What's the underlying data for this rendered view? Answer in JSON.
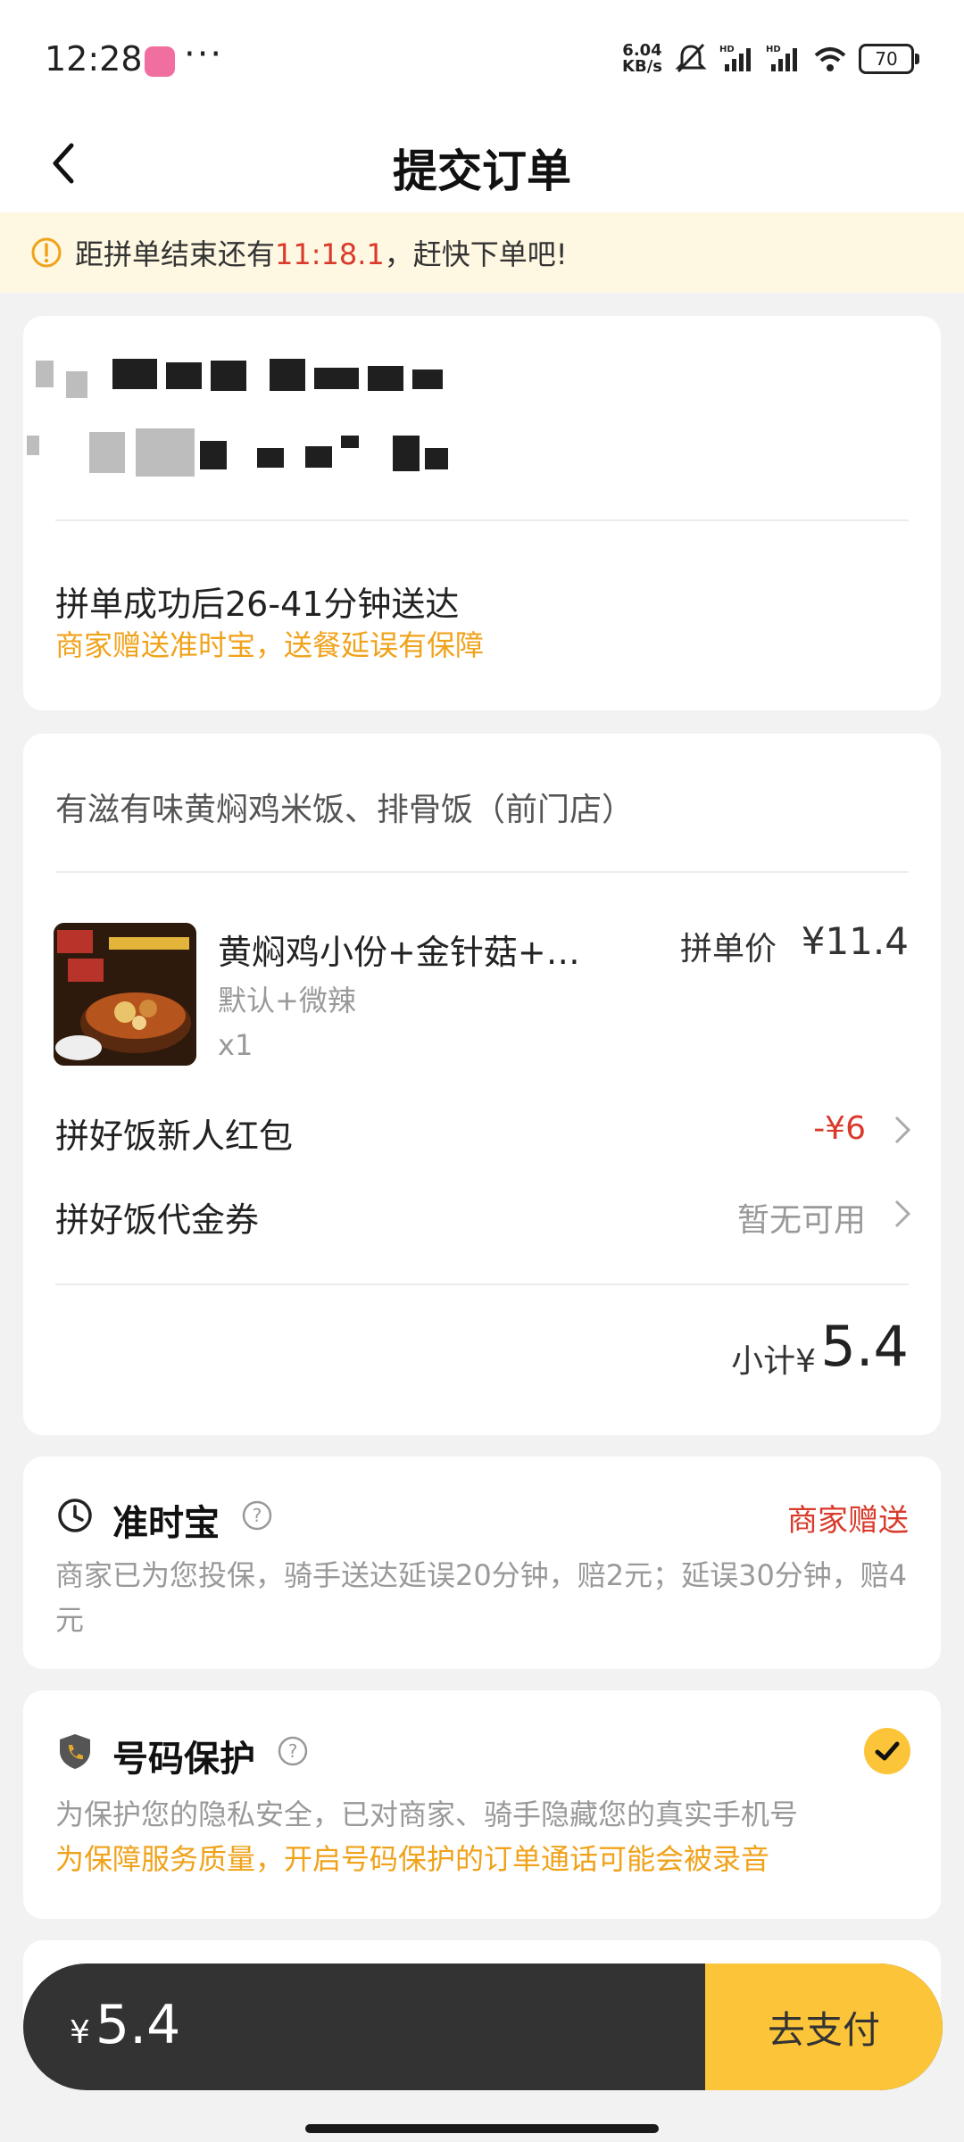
{
  "status_bar": {
    "time": "12:28",
    "dots": "···",
    "net_speed_value": "6.04",
    "net_speed_unit": "KB/s",
    "battery": "70"
  },
  "nav": {
    "title": "提交订单"
  },
  "notice": {
    "prefix": "距拼单结束还有",
    "countdown": "11:18.1",
    "suffix": "，赶快下单吧!"
  },
  "delivery": {
    "time_text": "拼单成功后26-41分钟送达",
    "guarantee_text": "商家赠送准时宝，送餐延误有保障"
  },
  "order": {
    "shop_name": "有滋有味黄焖鸡米饭、排骨饭（前门店）",
    "item": {
      "name": "黄焖鸡小份+金针菇+豆…",
      "spec": "默认+微辣",
      "qty": "x1",
      "price_label": "拼单价",
      "price": "¥11.4"
    },
    "rows": [
      {
        "label": "拼好饭新人红包",
        "value": "-¥6",
        "value_color": "#d93a2b"
      },
      {
        "label": "拼好饭代金券",
        "value": "暂无可用",
        "value_color": "#999999"
      }
    ],
    "subtotal_label": "小计¥",
    "subtotal_value": "5.4"
  },
  "on_time": {
    "title": "准时宝",
    "badge": "商家赠送",
    "desc": "商家已为您投保，骑手送达延误20分钟，赔2元；延误30分钟，赔4元"
  },
  "number_protect": {
    "title": "号码保护",
    "desc": "为保护您的隐私安全，已对商家、骑手隐藏您的真实手机号",
    "note": "为保障服务质量，开启号码保护的订单通话可能会被录音",
    "checked": true
  },
  "pay": {
    "currency": "¥",
    "amount": "5.4",
    "button": "去支付"
  },
  "colors": {
    "accent": "#fcc539",
    "warning_text": "#f0a21a",
    "red": "#d93a2b"
  }
}
